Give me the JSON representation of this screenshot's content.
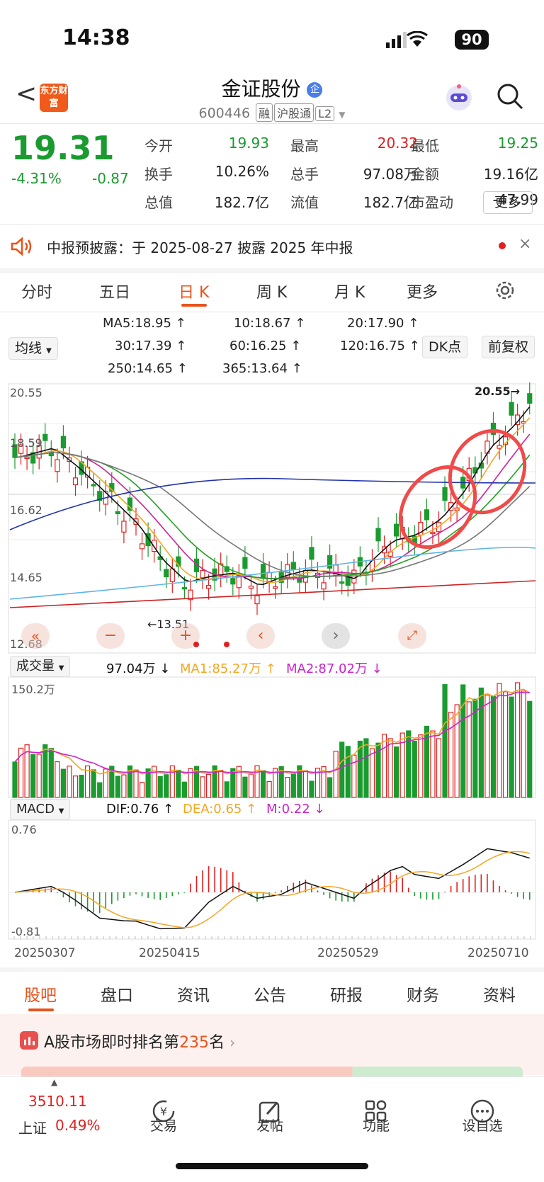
{
  "status": {
    "time": "14:38",
    "battery": "90"
  },
  "header": {
    "back_label": "<",
    "logo_text": "东方财富",
    "title": "金证股份",
    "enterprise_tag": "企",
    "code": "600446",
    "tags": [
      "融",
      "沪股通",
      "L2"
    ]
  },
  "quote": {
    "price": "19.31",
    "change_pct": "-4.31%",
    "change": "-0.87",
    "rows": [
      [
        {
          "label": "今开",
          "value": "19.93",
          "color": "green"
        },
        {
          "label": "最高",
          "value": "20.32",
          "color": "red"
        },
        {
          "label": "最低",
          "value": "19.25",
          "color": "green"
        }
      ],
      [
        {
          "label": "换手",
          "value": "10.26%",
          "color": "dark"
        },
        {
          "label": "总手",
          "value": "97.08万",
          "color": "dark"
        },
        {
          "label": "金额",
          "value": "19.16亿",
          "color": "dark"
        }
      ],
      [
        {
          "label": "总值",
          "value": "182.7亿",
          "color": "dark"
        },
        {
          "label": "流值",
          "value": "182.7亿",
          "color": "dark"
        },
        {
          "label": "市盈动",
          "value": "-47.99",
          "color": "dark"
        }
      ]
    ],
    "more_label": "更多"
  },
  "notice": {
    "text": "中报预披露：于 2025-08-27 披露 2025 年中报"
  },
  "tabs": [
    "分时",
    "五日",
    "日 K",
    "周 K",
    "月 K",
    "更多"
  ],
  "ma": {
    "selector": "均线",
    "items": [
      {
        "text": "MA5:18.95 ↑",
        "color": "#111111"
      },
      {
        "text": "10:18.67 ↑",
        "color": "#f5a623"
      },
      {
        "text": "20:17.90 ↑",
        "color": "#cc2299"
      },
      {
        "text": "30:17.39 ↑",
        "color": "#22a022"
      },
      {
        "text": "60:16.25 ↑",
        "color": "#777777"
      },
      {
        "text": "120:16.75 ↑",
        "color": "#2233aa"
      },
      {
        "text": "250:14.65 ↑",
        "color": "#5ab4e8"
      },
      {
        "text": "365:13.64 ↑",
        "color": "#cc2222"
      }
    ],
    "dk_label": "DK点",
    "adjust_label": "前复权"
  },
  "kline": {
    "y_labels": [
      "20.55",
      "18.59",
      "16.62",
      "14.65",
      "12.68"
    ],
    "high_marker": "20.55→",
    "low_marker": "←13.51"
  },
  "volume": {
    "selector": "成交量",
    "value": "97.04万 ↓",
    "ma1": "MA1:85.27万 ↑",
    "ma2": "MA2:87.02万 ↓",
    "max_label": "150.2万"
  },
  "macd": {
    "selector": "MACD",
    "dif": "DIF:0.76 ↑",
    "dea": "DEA:0.65 ↑",
    "m": "M:0.22 ↓",
    "top_label": "0.76",
    "bottom_label": "-0.81"
  },
  "dates": [
    "20250307",
    "20250415",
    "20250529",
    "20250710"
  ],
  "bottom_tabs": [
    "股吧",
    "盘口",
    "资讯",
    "公告",
    "研报",
    "财务",
    "资料"
  ],
  "rank": {
    "prefix": "A股市场即时排名第",
    "number": "235",
    "suffix": "名"
  },
  "footer": {
    "index_value": "3510.11",
    "index_name": "上证",
    "index_pct": "0.49%",
    "items": [
      "交易",
      "发帖",
      "功能",
      "设自选"
    ]
  }
}
